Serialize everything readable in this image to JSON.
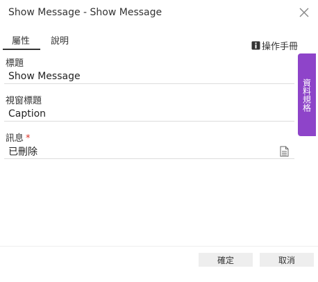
{
  "window": {
    "title": "Show Message - Show Message"
  },
  "tabs": [
    {
      "label": "屬性",
      "active": true
    },
    {
      "label": "說明",
      "active": false
    }
  ],
  "manual": {
    "label": "操作手冊",
    "icon": "book-icon"
  },
  "side_tab": {
    "label": "資料規格",
    "color": "#8e44c9"
  },
  "fields": {
    "title": {
      "label": "標題",
      "value": "Show Message"
    },
    "caption": {
      "label": "視窗標題",
      "value": "Caption"
    },
    "message": {
      "label": "訊息",
      "required_mark": "*",
      "value": "已刪除",
      "icon": "document-icon"
    }
  },
  "footer": {
    "ok_label": "確定",
    "cancel_label": "取消"
  }
}
